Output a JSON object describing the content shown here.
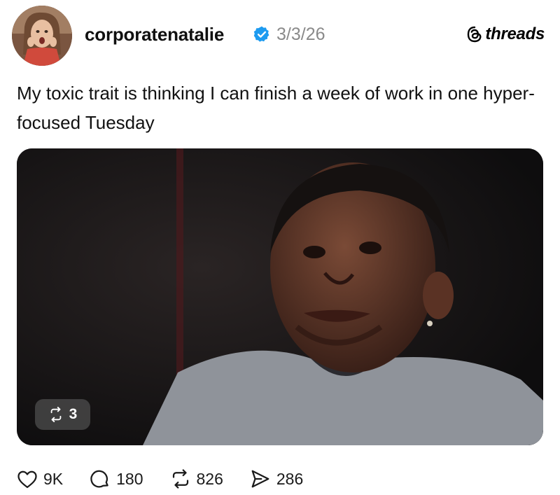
{
  "post": {
    "username": "corporatenatalie",
    "verified": true,
    "date": "3/3/26",
    "brand": "threads",
    "text": "My toxic trait is thinking I can finish a week of work in one hyper-focused Tuesday",
    "media": {
      "repost_count_badge": "3"
    },
    "actions": {
      "likes": "9K",
      "replies": "180",
      "reposts": "826",
      "shares": "286"
    }
  },
  "colors": {
    "verified_blue": "#1d9bf0",
    "date_gray": "#8a8a8a",
    "media_bg": "#121212"
  },
  "icons": [
    "threads-logo-icon",
    "verified-badge-icon",
    "repost-icon",
    "heart-icon",
    "reply-icon",
    "share-icon"
  ]
}
